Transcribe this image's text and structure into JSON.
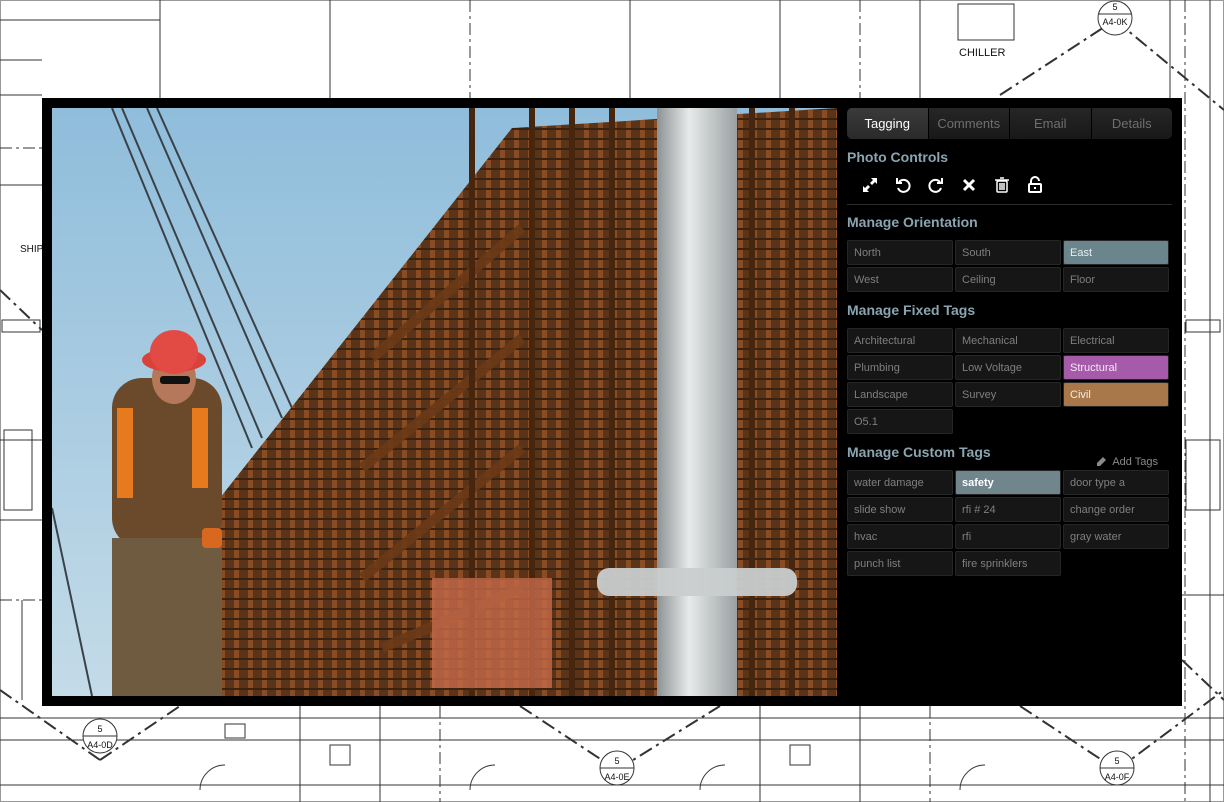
{
  "blueprint": {
    "labels": {
      "chiller": "CHILLER",
      "ship": "SHIP"
    },
    "markers": [
      {
        "num": "5",
        "ref": "A4-0K"
      },
      {
        "num": "5",
        "ref": "A4-0D"
      },
      {
        "num": "5",
        "ref": "A4-0E"
      },
      {
        "num": "5",
        "ref": "A4-0F"
      }
    ]
  },
  "tabs": [
    {
      "label": "Tagging",
      "active": true
    },
    {
      "label": "Comments",
      "active": false
    },
    {
      "label": "Email",
      "active": false
    },
    {
      "label": "Details",
      "active": false
    }
  ],
  "photo_controls": {
    "title": "Photo Controls",
    "icons": [
      "expand-icon",
      "rotate-left-icon",
      "rotate-right-icon",
      "close-icon",
      "trash-icon",
      "unlock-icon"
    ]
  },
  "orientation": {
    "title": "Manage Orientation",
    "options": [
      "North",
      "South",
      "East",
      "West",
      "Ceiling",
      "Floor"
    ],
    "selected": "East"
  },
  "fixed_tags": {
    "title": "Manage Fixed Tags",
    "tags": [
      "Architectural",
      "Mechanical",
      "Electrical",
      "Plumbing",
      "Low Voltage",
      "Structural",
      "Landscape",
      "Survey",
      "Civil",
      "O5.1"
    ],
    "selected": [
      "Structural",
      "Civil"
    ],
    "colors": {
      "Structural": "#a65aaa",
      "Civil": "#a9784a"
    }
  },
  "custom_tags": {
    "title": "Manage Custom Tags",
    "add_label": "Add Tags",
    "tags": [
      "water damage",
      "safety",
      "door type a",
      "slide show",
      "rfi # 24",
      "change order",
      "hvac",
      "rfi",
      "gray water",
      "punch list",
      "fire sprinklers"
    ],
    "selected": [
      "safety"
    ]
  }
}
